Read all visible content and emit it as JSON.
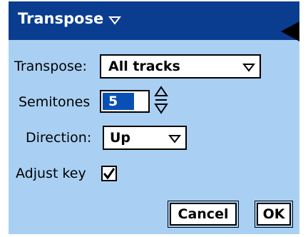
{
  "dialog": {
    "title": "Transpose",
    "colors": {
      "title_bar": "#0a3c90",
      "body": "#a9d0f3",
      "selection": "#0a50b4"
    }
  },
  "fields": {
    "transpose": {
      "label": "Transpose:",
      "value": "All tracks"
    },
    "semitones": {
      "label": "Semitones",
      "value": "5"
    },
    "direction": {
      "label": "Direction:",
      "value": "Up"
    },
    "adjust_key": {
      "label": "Adjust key",
      "checked": true
    }
  },
  "buttons": {
    "cancel": "Cancel",
    "ok": "OK"
  },
  "icons": {
    "title_menu": "chevron-down-icon",
    "corner": "left-arrow-icon",
    "stepper": "up-down-stepper-icon",
    "check": "checkmark-icon"
  }
}
